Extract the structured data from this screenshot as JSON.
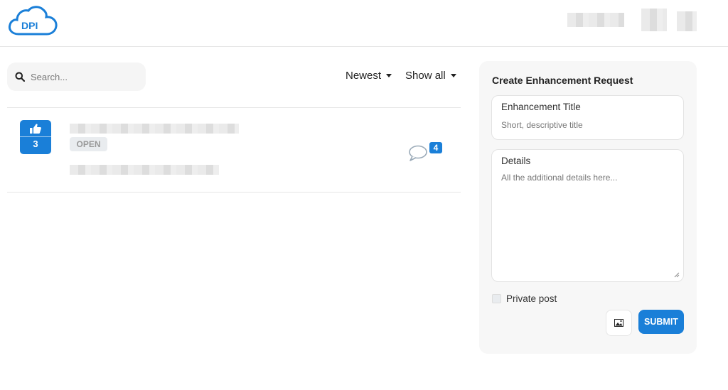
{
  "brand": {
    "logo_icon": "cloud-logo-icon",
    "accent_color": "#1a7fd8"
  },
  "search": {
    "placeholder": "Search...",
    "icon": "search-icon"
  },
  "filters": {
    "sort_label": "Newest",
    "scope_label": "Show all"
  },
  "post": {
    "votes": "3",
    "status": "OPEN",
    "comment_count": "4",
    "vote_icon": "thumbs-up-icon",
    "comment_icon": "comment-bubble-icon"
  },
  "form": {
    "heading": "Create Enhancement Request",
    "title_label": "Enhancement Title",
    "title_placeholder": "Short, descriptive title",
    "details_label": "Details",
    "details_placeholder": "All the additional details here...",
    "private_label": "Private post",
    "image_icon": "image-icon",
    "submit_label": "SUBMIT"
  }
}
